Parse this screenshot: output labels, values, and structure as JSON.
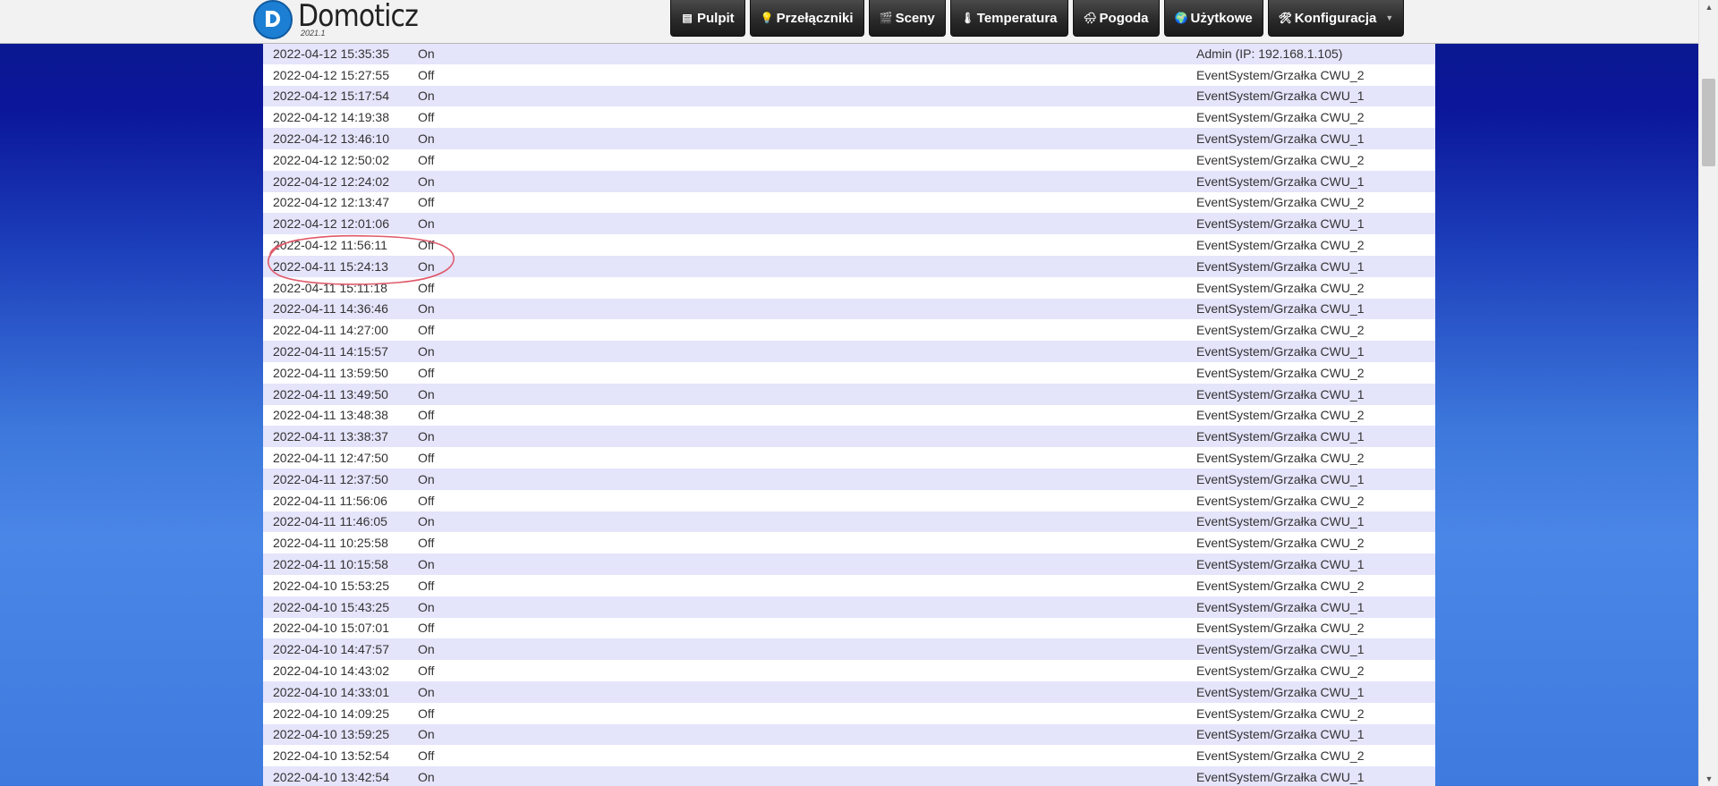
{
  "app": {
    "name": "Domoticz",
    "version": "2021.1"
  },
  "nav": [
    {
      "label": "Pulpit",
      "icon": "dashboard-icon",
      "glyph": "▤"
    },
    {
      "label": "Przełączniki",
      "icon": "lightbulb-icon",
      "glyph": "💡"
    },
    {
      "label": "Sceny",
      "icon": "clapperboard-icon",
      "glyph": "🎬"
    },
    {
      "label": "Temperatura",
      "icon": "thermometer-icon",
      "glyph": "🌡"
    },
    {
      "label": "Pogoda",
      "icon": "weather-icon",
      "glyph": "🌧"
    },
    {
      "label": "Użytkowe",
      "icon": "utility-icon",
      "glyph": "🌍"
    },
    {
      "label": "Konfiguracja",
      "icon": "tools-icon",
      "glyph": "🛠",
      "dropdown": true
    }
  ],
  "colors": {
    "row_odd": "#e4e4fb",
    "row_even": "#ffffff",
    "annotation": "#e05a6a",
    "logo": "#1c7fd3"
  },
  "log": [
    {
      "date": "2022-04-12 15:35:35",
      "state": "On",
      "user": "Admin (IP: 192.168.1.105)"
    },
    {
      "date": "2022-04-12 15:27:55",
      "state": "Off",
      "user": "EventSystem/Grzałka CWU_2"
    },
    {
      "date": "2022-04-12 15:17:54",
      "state": "On",
      "user": "EventSystem/Grzałka CWU_1"
    },
    {
      "date": "2022-04-12 14:19:38",
      "state": "Off",
      "user": "EventSystem/Grzałka CWU_2"
    },
    {
      "date": "2022-04-12 13:46:10",
      "state": "On",
      "user": "EventSystem/Grzałka CWU_1"
    },
    {
      "date": "2022-04-12 12:50:02",
      "state": "Off",
      "user": "EventSystem/Grzałka CWU_2"
    },
    {
      "date": "2022-04-12 12:24:02",
      "state": "On",
      "user": "EventSystem/Grzałka CWU_1"
    },
    {
      "date": "2022-04-12 12:13:47",
      "state": "Off",
      "user": "EventSystem/Grzałka CWU_2"
    },
    {
      "date": "2022-04-12 12:01:06",
      "state": "On",
      "user": "EventSystem/Grzałka CWU_1"
    },
    {
      "date": "2022-04-12 11:56:11",
      "state": "Off",
      "user": "EventSystem/Grzałka CWU_2"
    },
    {
      "date": "2022-04-11 15:24:13",
      "state": "On",
      "user": "EventSystem/Grzałka CWU_1"
    },
    {
      "date": "2022-04-11 15:11:18",
      "state": "Off",
      "user": "EventSystem/Grzałka CWU_2"
    },
    {
      "date": "2022-04-11 14:36:46",
      "state": "On",
      "user": "EventSystem/Grzałka CWU_1"
    },
    {
      "date": "2022-04-11 14:27:00",
      "state": "Off",
      "user": "EventSystem/Grzałka CWU_2"
    },
    {
      "date": "2022-04-11 14:15:57",
      "state": "On",
      "user": "EventSystem/Grzałka CWU_1"
    },
    {
      "date": "2022-04-11 13:59:50",
      "state": "Off",
      "user": "EventSystem/Grzałka CWU_2"
    },
    {
      "date": "2022-04-11 13:49:50",
      "state": "On",
      "user": "EventSystem/Grzałka CWU_1"
    },
    {
      "date": "2022-04-11 13:48:38",
      "state": "Off",
      "user": "EventSystem/Grzałka CWU_2"
    },
    {
      "date": "2022-04-11 13:38:37",
      "state": "On",
      "user": "EventSystem/Grzałka CWU_1"
    },
    {
      "date": "2022-04-11 12:47:50",
      "state": "Off",
      "user": "EventSystem/Grzałka CWU_2"
    },
    {
      "date": "2022-04-11 12:37:50",
      "state": "On",
      "user": "EventSystem/Grzałka CWU_1"
    },
    {
      "date": "2022-04-11 11:56:06",
      "state": "Off",
      "user": "EventSystem/Grzałka CWU_2"
    },
    {
      "date": "2022-04-11 11:46:05",
      "state": "On",
      "user": "EventSystem/Grzałka CWU_1"
    },
    {
      "date": "2022-04-11 10:25:58",
      "state": "Off",
      "user": "EventSystem/Grzałka CWU_2"
    },
    {
      "date": "2022-04-11 10:15:58",
      "state": "On",
      "user": "EventSystem/Grzałka CWU_1"
    },
    {
      "date": "2022-04-10 15:53:25",
      "state": "Off",
      "user": "EventSystem/Grzałka CWU_2"
    },
    {
      "date": "2022-04-10 15:43:25",
      "state": "On",
      "user": "EventSystem/Grzałka CWU_1"
    },
    {
      "date": "2022-04-10 15:07:01",
      "state": "Off",
      "user": "EventSystem/Grzałka CWU_2"
    },
    {
      "date": "2022-04-10 14:47:57",
      "state": "On",
      "user": "EventSystem/Grzałka CWU_1"
    },
    {
      "date": "2022-04-10 14:43:02",
      "state": "Off",
      "user": "EventSystem/Grzałka CWU_2"
    },
    {
      "date": "2022-04-10 14:33:01",
      "state": "On",
      "user": "EventSystem/Grzałka CWU_1"
    },
    {
      "date": "2022-04-10 14:09:25",
      "state": "Off",
      "user": "EventSystem/Grzałka CWU_2"
    },
    {
      "date": "2022-04-10 13:59:25",
      "state": "On",
      "user": "EventSystem/Grzałka CWU_1"
    },
    {
      "date": "2022-04-10 13:52:54",
      "state": "Off",
      "user": "EventSystem/Grzałka CWU_2"
    },
    {
      "date": "2022-04-10 13:42:54",
      "state": "On",
      "user": "EventSystem/Grzałka CWU_1"
    }
  ]
}
